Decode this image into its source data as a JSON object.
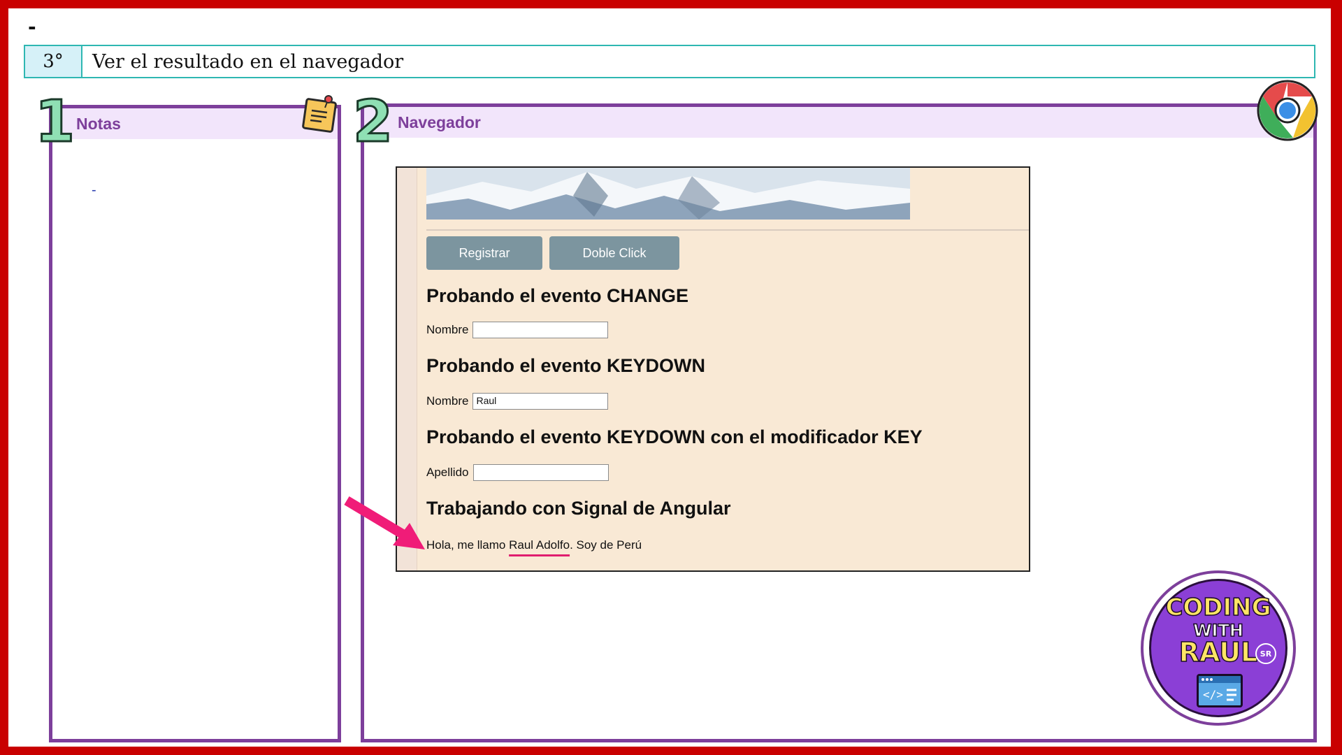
{
  "slide": {
    "top_dash": "-",
    "step_number": "3°",
    "step_title": "Ver el resultado en el navegador"
  },
  "notes_panel": {
    "number": "1",
    "title": "Notas",
    "content": "-"
  },
  "browser_panel": {
    "number": "2",
    "title": "Navegador"
  },
  "browser_page": {
    "buttons": {
      "register": "Registrar",
      "double_click": "Doble Click"
    },
    "section_change": {
      "title": "Probando el evento CHANGE",
      "label": "Nombre",
      "value": ""
    },
    "section_keydown": {
      "title": "Probando el evento KEYDOWN",
      "label": "Nombre",
      "value": "Raul"
    },
    "section_keydown_key": {
      "title": "Probando el evento KEYDOWN con el modificador KEY",
      "label": "Apellido",
      "value": ""
    },
    "section_signal": {
      "title": "Trabajando con Signal de Angular",
      "text_before": "Hola, me llamo ",
      "highlight": "Raul Adolfo",
      "text_after": ". Soy de Perú"
    }
  },
  "badge": {
    "line1": "CODING",
    "line2": "WITH",
    "line3": "RAUL",
    "suffix": "SR"
  },
  "colors": {
    "frame": "#c90000",
    "accent_purple": "#7d3f9b",
    "step_border": "#2eb7b2",
    "page_bg": "#f9e9d5",
    "button": "#7c959f",
    "highlight_pink": "#e01e6f"
  },
  "icons": [
    "sticky-note-icon",
    "chrome-icon",
    "arrow-icon",
    "code-window-icon"
  ]
}
